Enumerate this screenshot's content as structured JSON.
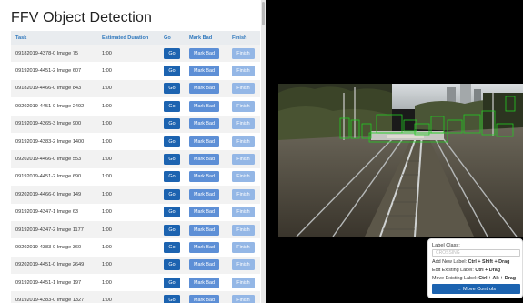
{
  "app": {
    "title": "FFV Object Detection"
  },
  "table": {
    "headers": [
      "Task",
      "Estimated Duration",
      "Go",
      "Mark Bad",
      "Finish"
    ],
    "go_label": "Go",
    "mark_bad_label": "Mark Bad",
    "finish_label": "Finish",
    "rows": [
      {
        "task": "09182019-4378-0 Image 75",
        "duration": "1:00"
      },
      {
        "task": "09192019-4451-2 Image 607",
        "duration": "1:00"
      },
      {
        "task": "09182019-4466-0 Image 843",
        "duration": "1:00"
      },
      {
        "task": "09202019-4451-0 Image 2492",
        "duration": "1:00"
      },
      {
        "task": "09192019-4365-3 Image 900",
        "duration": "1:00"
      },
      {
        "task": "09192019-4383-2 Image 1400",
        "duration": "1:00"
      },
      {
        "task": "09202019-4466-0 Image 553",
        "duration": "1:00"
      },
      {
        "task": "09192019-4451-2 Image 690",
        "duration": "1:00"
      },
      {
        "task": "09202019-4466-0 Image 149",
        "duration": "1:00"
      },
      {
        "task": "09192019-4347-1 Image 63",
        "duration": "1:00"
      },
      {
        "task": "09192019-4347-2 Image 1177",
        "duration": "1:00"
      },
      {
        "task": "09202019-4383-0 Image 360",
        "duration": "1:00"
      },
      {
        "task": "09202019-4451-0 Image 2649",
        "duration": "1:00"
      },
      {
        "task": "09192019-4451-1 Image 197",
        "duration": "1:00"
      },
      {
        "task": "09192019-4383-0 Image 1327",
        "duration": "1:00"
      }
    ]
  },
  "controls": {
    "label_class_title": "Label Class:",
    "label_class_value": "CROSSING",
    "add_label_text": "Add New Label:",
    "add_label_keys": "Ctrl + Shift + Drag",
    "edit_label_text": "Edit Existing Label:",
    "edit_label_keys": "Ctrl + Drag",
    "move_label_text": "Move Existing Label:",
    "move_label_keys": "Ctrl + Alt + Drag",
    "move_controls_label": "← Move Controls"
  },
  "colors": {
    "header_text": "#2e77bc",
    "go_button": "#1c63b0",
    "mark_bad_button": "#5d8fd6",
    "finish_button": "#94b7e6",
    "detection_box": "#22cc22"
  }
}
